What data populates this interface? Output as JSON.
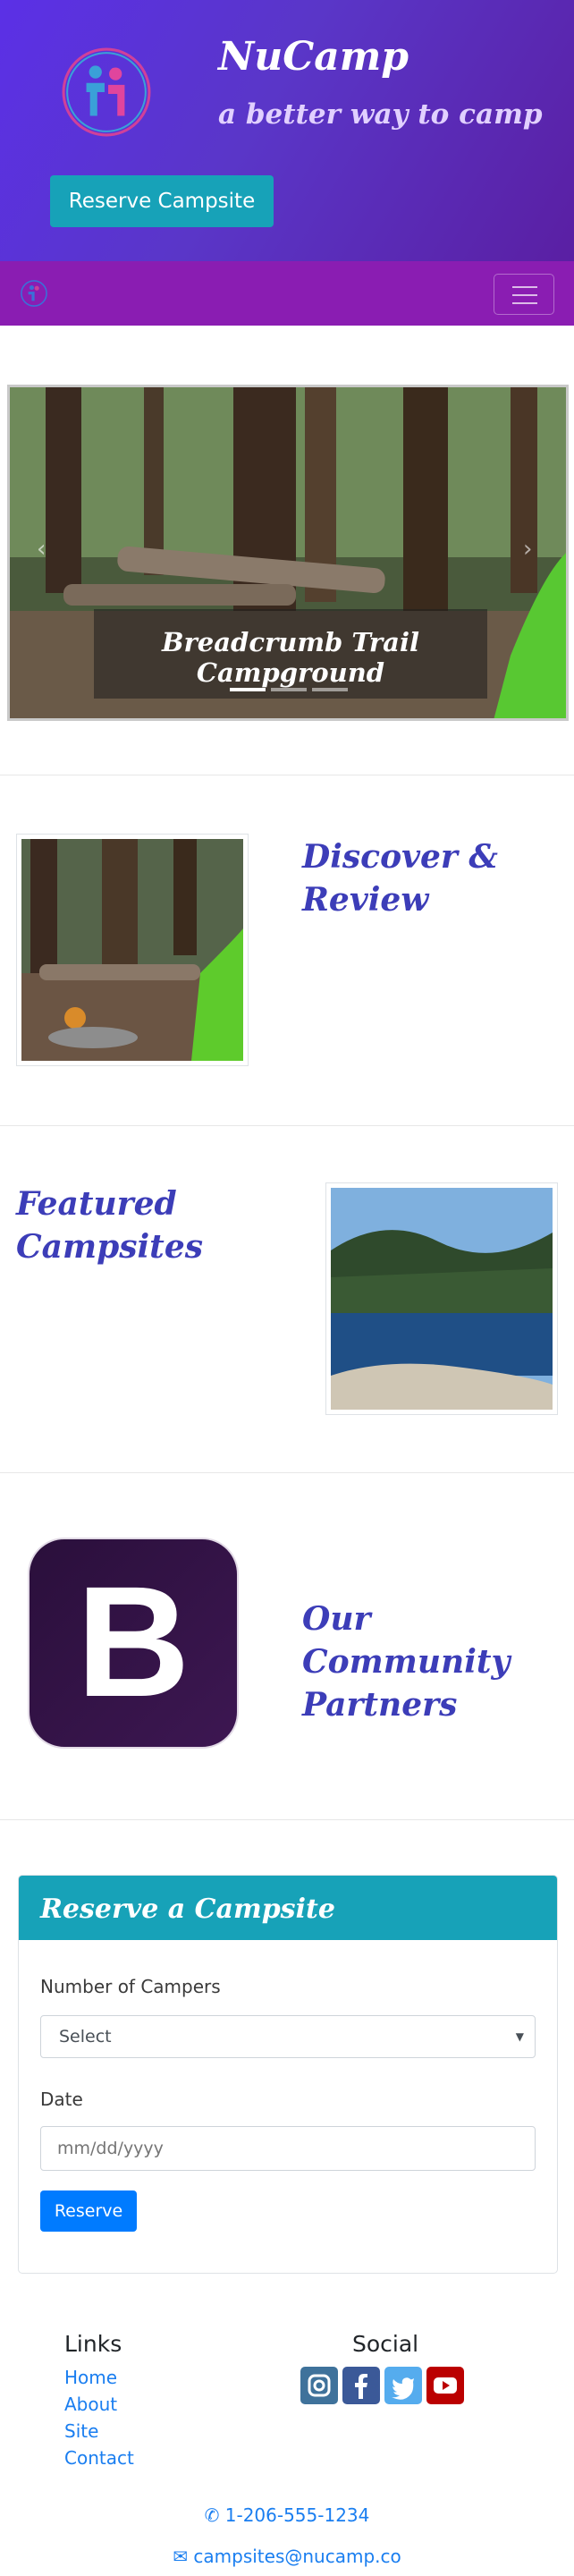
{
  "header": {
    "brand": "NuCamp",
    "tagline": "a better way to camp",
    "reserve_button": "Reserve Campsite"
  },
  "navbar": {
    "toggler_icon": "hamburger-icon"
  },
  "carousel": {
    "caption": "Breadcrumb Trail Campground",
    "slide_count": 3,
    "active_index": 0
  },
  "features": [
    {
      "heading": "Discover & Review",
      "image": "campfire-with-tent"
    },
    {
      "heading": "Featured Campsites",
      "image": "mountain-lake"
    },
    {
      "heading": "Our Community Partners",
      "image": "bootstrap-logo"
    }
  ],
  "partner_logo_letter": "B",
  "reserve_form": {
    "title": "Reserve a Campsite",
    "campers_label": "Number of Campers",
    "campers_value": "Select",
    "date_label": "Date",
    "date_placeholder": "mm/dd/yyyy",
    "submit": "Reserve"
  },
  "footer": {
    "links_heading": "Links",
    "links": [
      "Home",
      "About",
      "Site",
      "Contact"
    ],
    "social_heading": "Social",
    "social": [
      {
        "name": "instagram-icon",
        "color": "#3f729b"
      },
      {
        "name": "facebook-icon",
        "color": "#3b5998"
      },
      {
        "name": "twitter-icon",
        "color": "#55acee"
      },
      {
        "name": "youtube-icon",
        "color": "#bb0000"
      }
    ],
    "phone": "1-206-555-1234",
    "email": "campsites@nucamp.co"
  },
  "colors": {
    "header_gradient_start": "#5b30e6",
    "header_gradient_end": "#5a1fa3",
    "navbar": "#8a1db2",
    "info": "#17a2b8",
    "primary": "#007bff",
    "heading": "#3c3db8"
  }
}
